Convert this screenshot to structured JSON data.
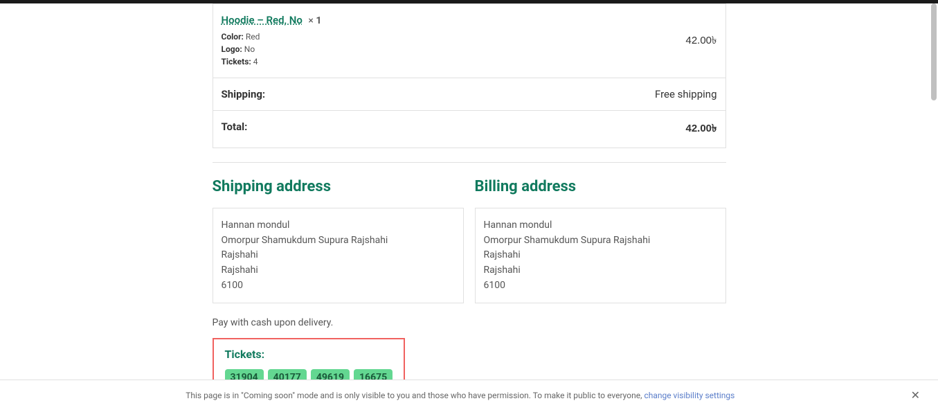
{
  "product": {
    "name": "Hoodie – Red, No",
    "qty_prefix": "×",
    "qty": "1",
    "meta": {
      "color_label": "Color:",
      "color_value": "Red",
      "logo_label": "Logo:",
      "logo_value": "No",
      "tickets_label": "Tickets:",
      "tickets_value": "4"
    },
    "price": "42.00৳"
  },
  "shipping_row": {
    "label": "Shipping:",
    "value": "Free shipping"
  },
  "total_row": {
    "label": "Total:",
    "value": "42.00৳"
  },
  "shipping_address": {
    "heading": "Shipping address",
    "lines": {
      "l0": "Hannan mondul",
      "l1": "Omorpur Shamukdum Supura Rajshahi",
      "l2": "Rajshahi",
      "l3": "Rajshahi",
      "l4": "6100"
    }
  },
  "billing_address": {
    "heading": "Billing address",
    "lines": {
      "l0": "Hannan mondul",
      "l1": "Omorpur Shamukdum Supura Rajshahi",
      "l2": "Rajshahi",
      "l3": "Rajshahi",
      "l4": "6100"
    }
  },
  "pay_note": "Pay with cash upon delivery.",
  "tickets": {
    "heading": "Tickets:",
    "items": {
      "t0": "31904",
      "t1": "40177",
      "t2": "49619",
      "t3": "16675"
    }
  },
  "footer": {
    "text_before": "This page is in \"Coming soon\" mode and is only visible to you and those who have permission. To make it public to everyone, ",
    "link": "change visibility settings"
  }
}
